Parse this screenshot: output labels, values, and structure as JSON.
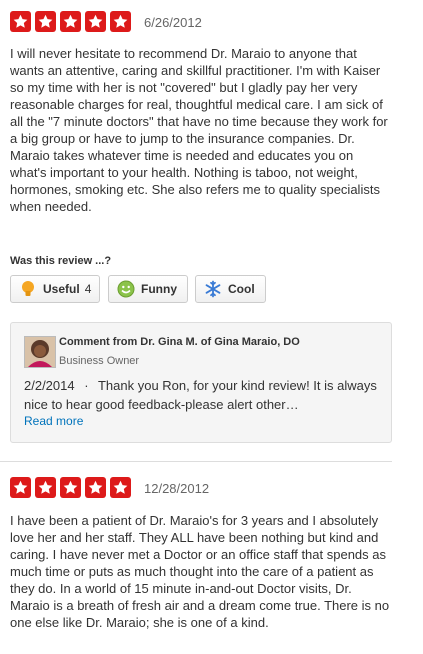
{
  "reviews": [
    {
      "rating": 5,
      "date": "6/26/2012",
      "text": "I will never hesitate to recommend Dr. Maraio to anyone that wants an attentive, caring and skillful practitioner.  I'm with Kaiser so my time with her is not \"covered\" but I gladly pay her very reasonable charges for real, thoughtful medical care.  I am sick of all the \"7 minute doctors\" that have no time because they work for a big group or have to jump to the insurance companies.  Dr. Maraio takes whatever time is needed and educates you on what's important to your health.  Nothing is taboo, not weight, hormones, smoking etc.  She also refers me to quality specialists when needed.",
      "vote_prompt": "Was this review ...?",
      "votes": {
        "useful_label": "Useful",
        "useful_count": "4",
        "funny_label": "Funny",
        "cool_label": "Cool"
      },
      "owner_comment": {
        "title": "Comment from Dr. Gina M. of Gina Maraio, DO",
        "role": "Business Owner",
        "date": "2/2/2014",
        "separator": "·",
        "text": "Thank you Ron, for your kind review!  It is always nice to hear good feedback-please alert other…",
        "read_more": "Read more"
      }
    },
    {
      "rating": 5,
      "date": "12/28/2012",
      "text": "I have been a patient of Dr. Maraio's for 3 years and I absolutely love her and her staff. They ALL have been nothing but kind and caring. I have never met a Doctor or an office staff that spends as much time or puts as much thought into the care of a patient as they do. In a world of 15 minute in-and-out Doctor visits, Dr. Maraio is a breath of fresh air and a dream come true. There is no one else like Dr. Maraio; she is one of a kind."
    }
  ],
  "colors": {
    "star_bg": "#dd1a1a",
    "link": "#0073bb",
    "useful_icon": "#f5a623",
    "funny_icon": "#8bc34a",
    "cool_icon": "#3a7bd5"
  },
  "icons": [
    "star-icon",
    "lightbulb-icon",
    "smiley-icon",
    "snowflake-icon",
    "avatar-photo"
  ]
}
